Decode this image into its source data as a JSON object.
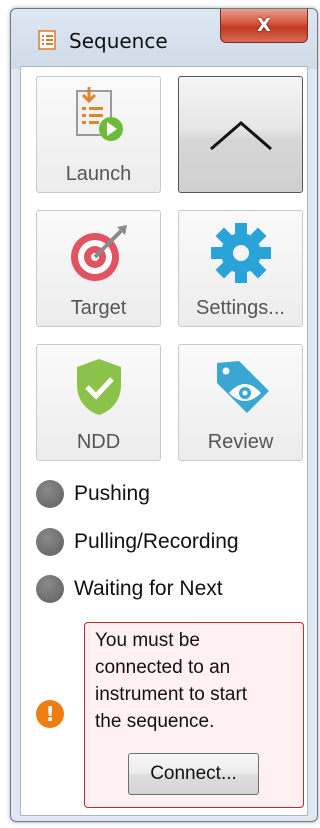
{
  "window": {
    "title": "Sequence",
    "close_symbol": "X"
  },
  "tiles": [
    {
      "label": "Launch",
      "icon": "launch-icon"
    },
    {
      "label": "",
      "icon": "chevron-up-icon"
    },
    {
      "label": "Target",
      "icon": "target-icon"
    },
    {
      "label": "Settings...",
      "icon": "gear-icon"
    },
    {
      "label": "NDD",
      "icon": "shield-check-icon"
    },
    {
      "label": "Review",
      "icon": "eye-tag-icon"
    }
  ],
  "status": [
    {
      "label": "Pushing"
    },
    {
      "label": "Pulling/Recording"
    },
    {
      "label": "Waiting for Next"
    }
  ],
  "warning": {
    "icon_symbol": "!",
    "lines": [
      "You must be",
      "connected to an",
      "instrument to start",
      "the sequence."
    ],
    "button_label": "Connect..."
  },
  "colors": {
    "target_red": "#e2525f",
    "gear_blue": "#2aa3d8",
    "shield_green": "#8bc34a",
    "eye_tag_blue": "#3aa6d4",
    "warning_orange": "#ef7e12",
    "warning_border": "#c12b2b",
    "status_dot": "#6a6a6a"
  }
}
